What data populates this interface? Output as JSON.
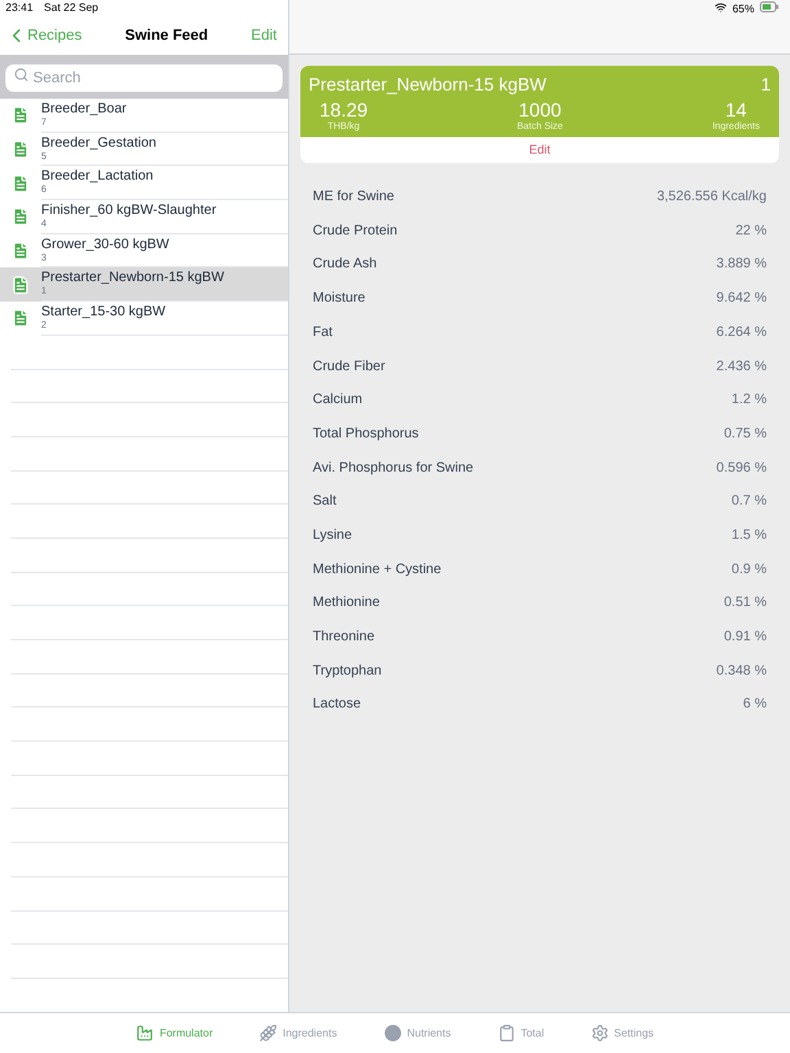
{
  "status_bar": {
    "time": "23:41",
    "date": "Sat 22 Sep",
    "battery": "65%"
  },
  "nav": {
    "back": "Recipes",
    "title": "Swine Feed",
    "action": "Edit"
  },
  "search": {
    "placeholder": "Search"
  },
  "recipes": [
    {
      "name": "Breeder_Boar",
      "count": "7",
      "selected": false
    },
    {
      "name": "Breeder_Gestation",
      "count": "5",
      "selected": false
    },
    {
      "name": "Breeder_Lactation",
      "count": "6",
      "selected": false
    },
    {
      "name": "Finisher_60 kgBW-Slaughter",
      "count": "4",
      "selected": false
    },
    {
      "name": "Grower_30-60 kgBW",
      "count": "3",
      "selected": false
    },
    {
      "name": "Prestarter_Newborn-15 kgBW",
      "count": "1",
      "selected": true
    },
    {
      "name": "Starter_15-30 kgBW",
      "count": "2",
      "selected": false
    }
  ],
  "card": {
    "title": "Prestarter_Newborn-15 kgBW",
    "number": "1",
    "stats": [
      {
        "value": "18.29",
        "label": "THB/kg"
      },
      {
        "value": "1000",
        "label": "Batch Size"
      },
      {
        "value": "14",
        "label": "Ingredients"
      }
    ],
    "edit": "Edit"
  },
  "nutrients": [
    {
      "name": "ME for Swine",
      "value": "3,526.556 Kcal/kg"
    },
    {
      "name": "Crude Protein",
      "value": "22 %"
    },
    {
      "name": "Crude Ash",
      "value": "3.889 %"
    },
    {
      "name": "Moisture",
      "value": "9.642 %"
    },
    {
      "name": "Fat",
      "value": "6.264 %"
    },
    {
      "name": "Crude Fiber",
      "value": "2.436 %"
    },
    {
      "name": "Calcium",
      "value": "1.2 %"
    },
    {
      "name": "Total Phosphorus",
      "value": "0.75 %"
    },
    {
      "name": "Avi. Phosphorus for Swine",
      "value": "0.596 %"
    },
    {
      "name": "Salt",
      "value": "0.7 %"
    },
    {
      "name": "Lysine",
      "value": "1.5 %"
    },
    {
      "name": "Methionine + Cystine",
      "value": "0.9 %"
    },
    {
      "name": "Methionine",
      "value": "0.51 %"
    },
    {
      "name": "Threonine",
      "value": "0.91 %"
    },
    {
      "name": "Tryptophan",
      "value": "0.348 %"
    },
    {
      "name": "Lactose",
      "value": "6 %"
    }
  ],
  "tabs": [
    {
      "label": "Formulator",
      "kind": "factory",
      "selected": true
    },
    {
      "label": "Ingredients",
      "kind": "grain",
      "selected": false
    },
    {
      "label": "Nutrients",
      "kind": "circle",
      "selected": false
    },
    {
      "label": "Total",
      "kind": "clipboard",
      "selected": false
    },
    {
      "label": "Settings",
      "kind": "gear",
      "selected": false
    }
  ]
}
